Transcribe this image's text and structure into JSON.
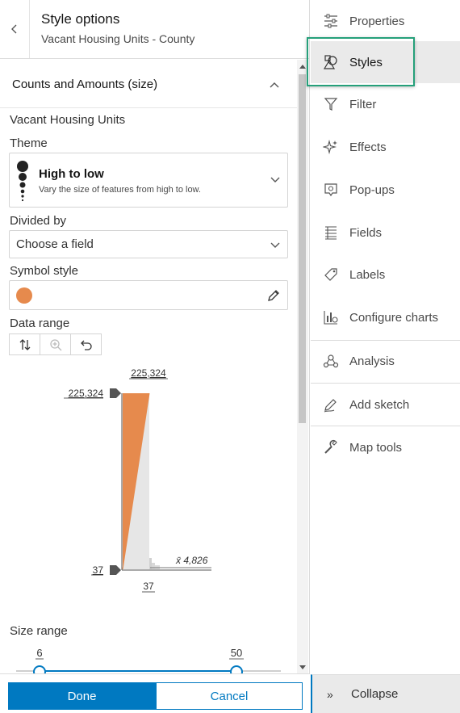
{
  "header": {
    "title": "Style options",
    "subtitle": "Vacant Housing Units - County"
  },
  "section": {
    "title": "Counts and Amounts (size)"
  },
  "field_label": "Vacant Housing Units",
  "theme": {
    "label": "Theme",
    "name": "High to low",
    "description": "Vary the size of features from high to low."
  },
  "divided_by": {
    "label": "Divided by",
    "value": "Choose a field"
  },
  "symbol_style": {
    "label": "Symbol style",
    "color": "#e68a4d"
  },
  "data_range": {
    "label": "Data range",
    "max_top": "225,324",
    "max_handle": "225,324",
    "min_handle": "37",
    "min_bottom": "37",
    "mean": "x̄ 4,826"
  },
  "size_range": {
    "label": "Size range",
    "min": "6",
    "max": "50"
  },
  "footer": {
    "done": "Done",
    "cancel": "Cancel"
  },
  "rail": {
    "items": [
      {
        "label": "Properties",
        "icon": "properties-icon"
      },
      {
        "label": "Styles",
        "icon": "styles-icon"
      },
      {
        "label": "Filter",
        "icon": "filter-icon"
      },
      {
        "label": "Effects",
        "icon": "effects-icon"
      },
      {
        "label": "Pop-ups",
        "icon": "popups-icon"
      },
      {
        "label": "Fields",
        "icon": "fields-icon"
      },
      {
        "label": "Labels",
        "icon": "labels-icon"
      },
      {
        "label": "Configure charts",
        "icon": "configure-charts-icon"
      },
      {
        "label": "Analysis",
        "icon": "analysis-icon"
      },
      {
        "label": "Add sketch",
        "icon": "add-sketch-icon"
      },
      {
        "label": "Map tools",
        "icon": "map-tools-icon"
      }
    ],
    "collapse": "Collapse",
    "collapse_icon": "»"
  },
  "colors": {
    "accent": "#0079c1",
    "highlight": "#25a07a",
    "symbol": "#e68a4d"
  }
}
